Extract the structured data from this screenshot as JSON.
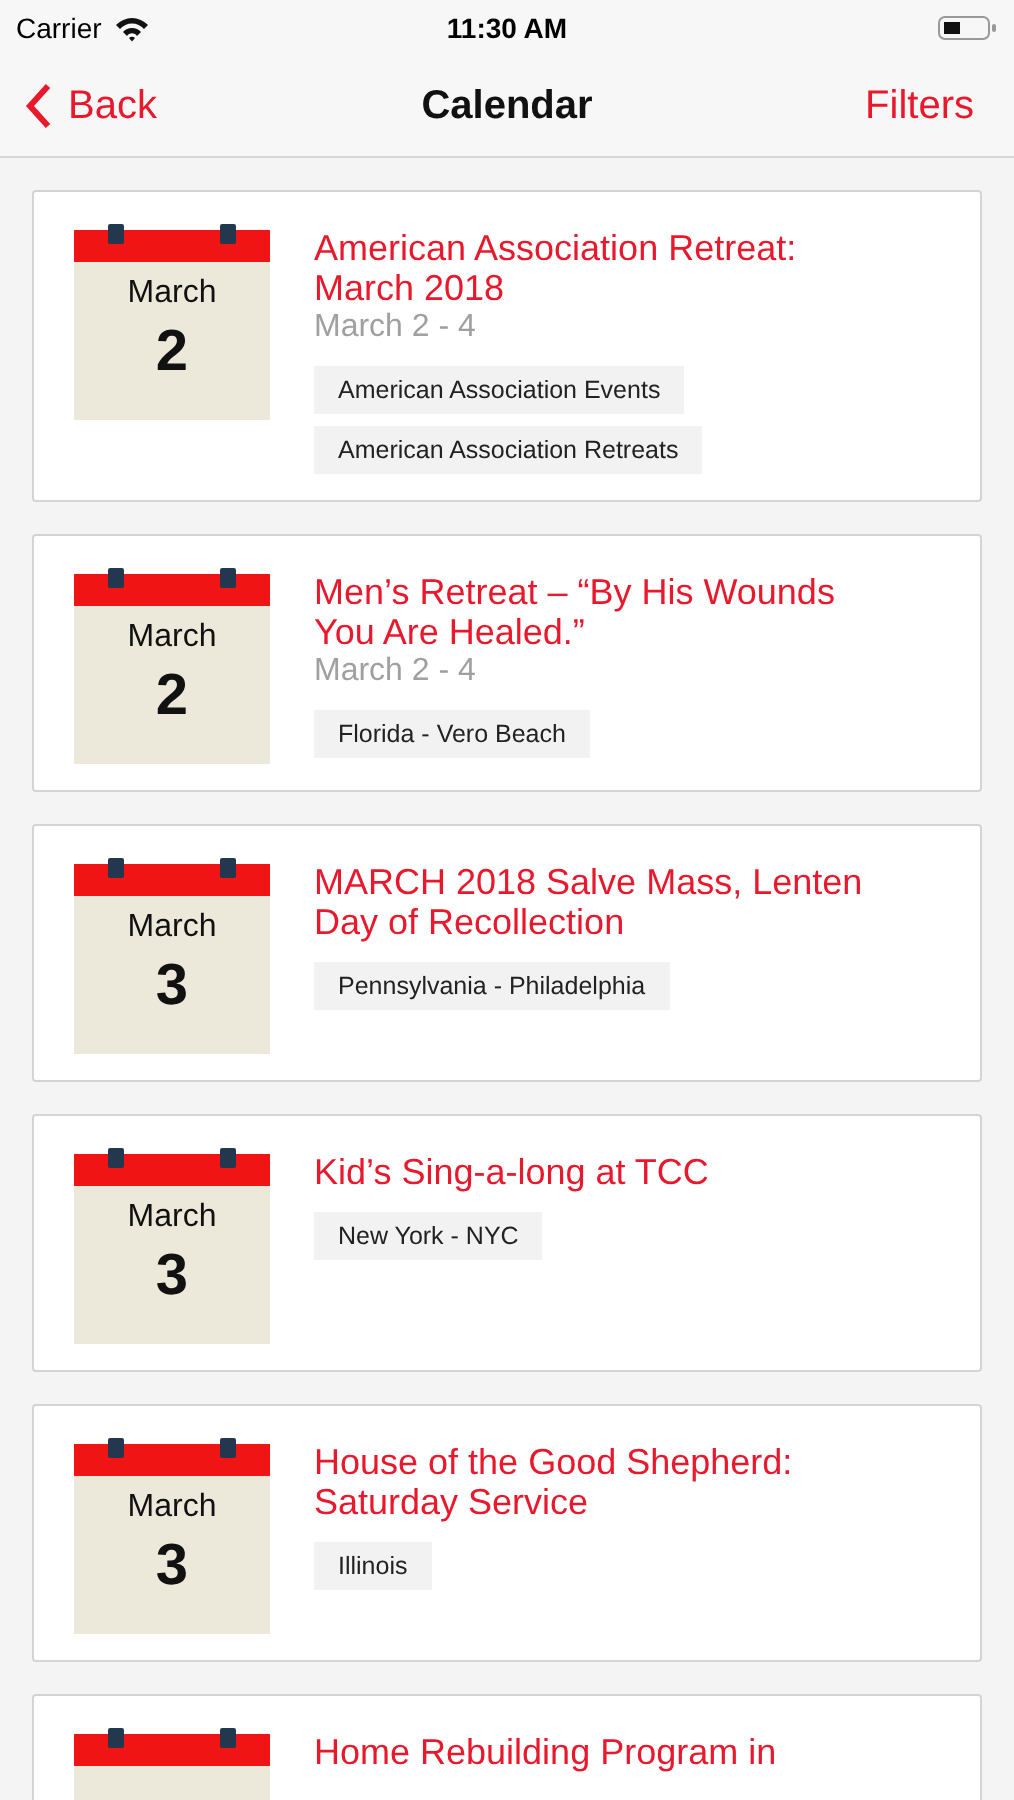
{
  "status_bar": {
    "carrier": "Carrier",
    "time": "11:30 AM"
  },
  "nav": {
    "back": "Back",
    "title": "Calendar",
    "action": "Filters"
  },
  "events": [
    {
      "month": "March",
      "day": "2",
      "title": "American Association Retreat: March 2018",
      "dates": "March 2 - 4",
      "tags": [
        "American Association Events",
        "American Association Retreats"
      ]
    },
    {
      "month": "March",
      "day": "2",
      "title": "Men’s Retreat – “By His Wounds You Are Healed.”",
      "dates": "March 2 - 4",
      "tags": [
        "Florida - Vero Beach"
      ]
    },
    {
      "month": "March",
      "day": "3",
      "title": "MARCH 2018 Salve Mass, Lenten Day of Recollection",
      "tags": [
        "Pennsylvania - Philadelphia"
      ]
    },
    {
      "month": "March",
      "day": "3",
      "title": "Kid’s Sing-a-long at TCC",
      "tags": [
        "New York - NYC"
      ]
    },
    {
      "month": "March",
      "day": "3",
      "title": "House of the Good Shepherd: Saturday Service",
      "tags": [
        "Illinois"
      ]
    },
    {
      "title": "Home Rebuilding Program in"
    }
  ]
}
